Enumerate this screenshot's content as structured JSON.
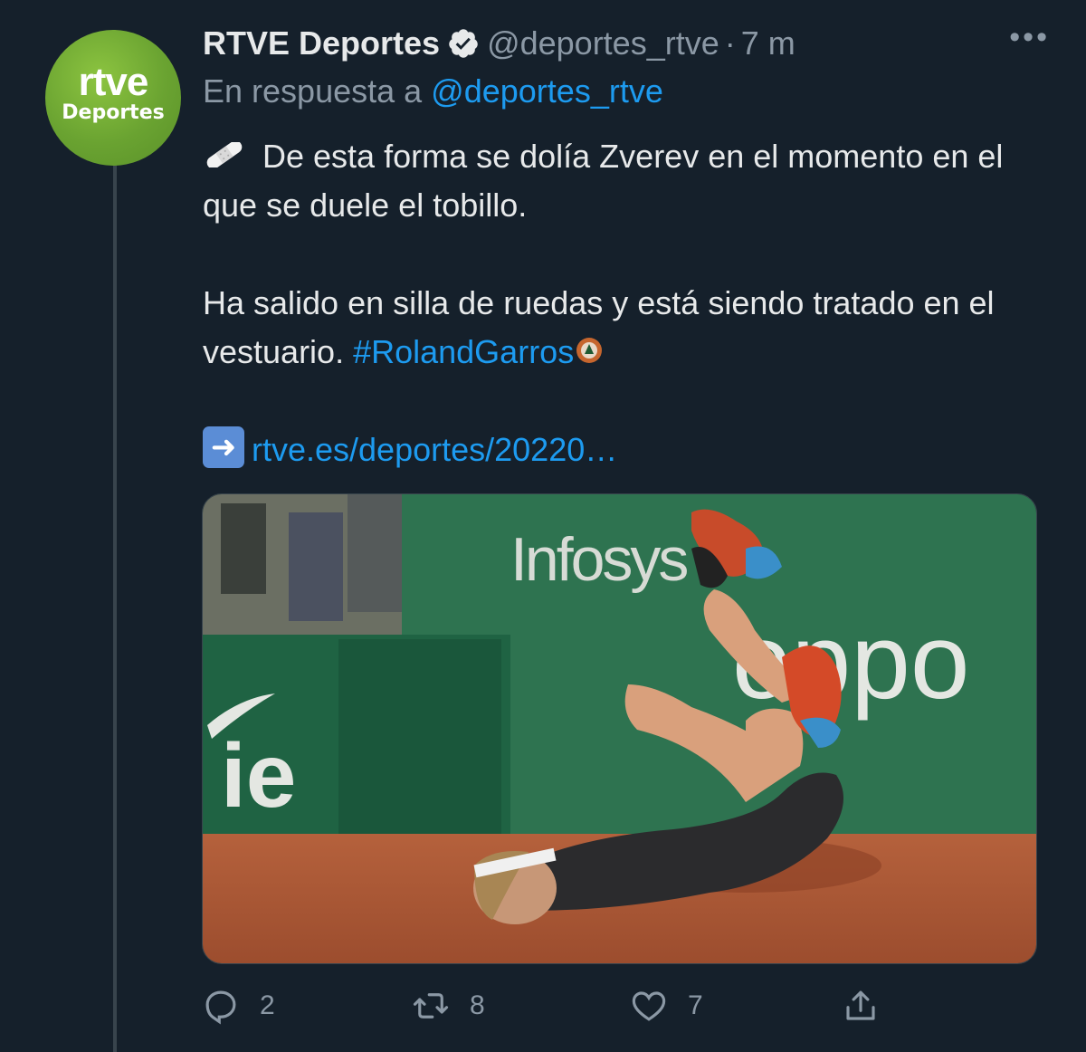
{
  "tweet": {
    "author": {
      "name": "RTVE Deportes",
      "handle": "@deportes_rtve",
      "time": "7 m",
      "avatar_line1": "rtve",
      "avatar_line2": "Deportes",
      "verified": true
    },
    "reply_label": "En respuesta a ",
    "reply_handle": "@deportes_rtve",
    "text_line1": "De esta forma se dolía Zverev en el momento en el que se duele el tobillo.",
    "text_line2": "Ha salido en silla de ruedas y está siendo tratado en el vestuario. ",
    "hashtag": "#RolandGarros",
    "link": "rtve.es/deportes/20220…",
    "media": {
      "banner_1": "Infosys",
      "banner_2": "oppo",
      "banner_3": "ie"
    },
    "actions": {
      "replies": "2",
      "retweets": "8",
      "likes": "7"
    }
  },
  "colors": {
    "background": "#15202b",
    "accent": "#1d9bf0",
    "muted": "#8b98a5"
  }
}
